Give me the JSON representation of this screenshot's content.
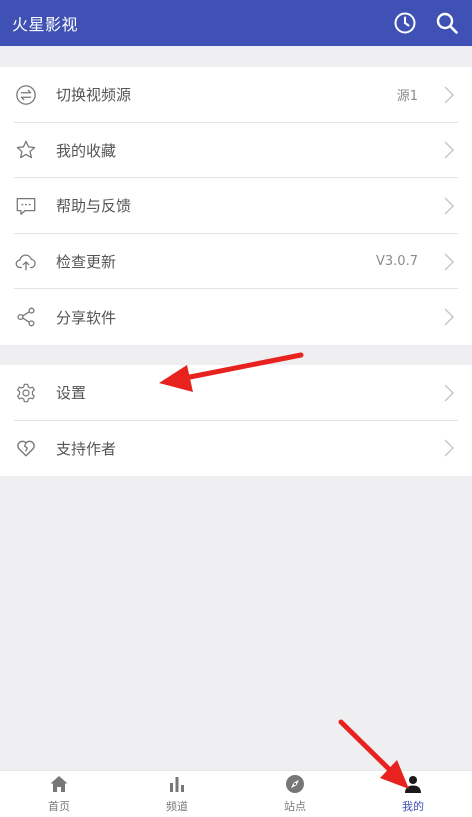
{
  "app": {
    "title": "火星影视"
  },
  "header_icons": [
    "clock-icon",
    "search-icon"
  ],
  "menu_section_1": [
    {
      "label": "切换视频源",
      "value": "源1",
      "icon": "swap-icon"
    },
    {
      "label": "我的收藏",
      "value": "",
      "icon": "star-icon"
    },
    {
      "label": "帮助与反馈",
      "value": "",
      "icon": "chat-icon"
    },
    {
      "label": "检查更新",
      "value": "V3.0.7",
      "icon": "cloud-upload-icon"
    },
    {
      "label": "分享软件",
      "value": "",
      "icon": "share-icon"
    }
  ],
  "menu_section_2": [
    {
      "label": "设置",
      "value": "",
      "icon": "gear-icon"
    },
    {
      "label": "支持作者",
      "value": "",
      "icon": "heart-icon"
    }
  ],
  "bottom_nav": [
    {
      "label": "首页",
      "icon": "home-icon",
      "active": false
    },
    {
      "label": "频道",
      "icon": "bar-chart-icon",
      "active": false
    },
    {
      "label": "站点",
      "icon": "compass-icon",
      "active": false
    },
    {
      "label": "我的",
      "icon": "person-icon",
      "active": true
    }
  ],
  "colors": {
    "primary": "#3f51b5",
    "annotation_arrow": "#e8231f",
    "background": "#efeef1"
  }
}
